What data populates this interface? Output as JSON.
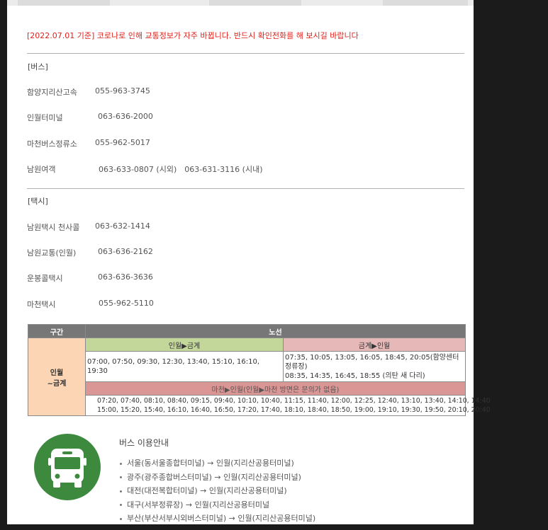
{
  "notice": {
    "prefix": "[2022.07.01 기준]",
    "text": " 코로나로 인해 교통정보가 자주 바뀝니다. 반드시 확인전화를 해 보시길 바랍니다"
  },
  "bus_section": {
    "title": "[버스]",
    "items": [
      {
        "name": "함양지리산고속",
        "phone": "055-963-3745"
      },
      {
        "name": "인월터미널",
        "phone": "063-636-2000"
      },
      {
        "name": "마천버스정류소",
        "phone": "055-962-5017"
      },
      {
        "name": "남원여객",
        "phone": "063-633-0807 (시외)　063-631-3116 (시내)"
      }
    ]
  },
  "taxi_section": {
    "title": "[택시]",
    "items": [
      {
        "name": "남원택시 천사콜",
        "phone": "063-632-1414"
      },
      {
        "name": "남원교통(인월)",
        "phone": "063-636-2162"
      },
      {
        "name": "운봉콜택시",
        "phone": "063-636-3636"
      },
      {
        "name": "마천택시",
        "phone": "055-962-5110"
      }
    ]
  },
  "timetable": {
    "col_section": "구간",
    "col_route": "노선",
    "section_name_line1": "인월",
    "section_name_line2": "~금계",
    "route_a": "인월▶금계",
    "route_b": "금계▶인월",
    "route_a_times": "07:00, 07:50, 09:30, 12:30, 13:40, 15:10, 16:10, 19:30",
    "route_b_times_1": "07:35, 10:05, 13:05, 16:05, 18:45, 20:05(함양센터 정류장)",
    "route_b_times_2": "08:35, 14:35, 16:45, 18:55 (의탄 새 다리)",
    "route_c": "마천▶인월(인월▶마천 방면은 문의가 없음)",
    "route_c_times_1": "07:20, 07:40, 08:10, 08:40, 09:15, 09:40, 10:10, 10:40, 11:15, 11:40, 12:00, 12:25, 12:40, 13:10, 13:40, 14:10, 14:40",
    "route_c_times_2": "15:00, 15:20, 15:40, 16:10, 16:40, 16:50, 17:20, 17:40, 18:10, 18:40, 18:50, 19:00, 19:10, 19:30, 19:50, 20:10, 20:40"
  },
  "bus_guide": {
    "icon": "bus-icon",
    "title": "버스 이용안내",
    "items": [
      "서울(동서울종합터미널) → 인월(지리산공용터미널)",
      "광주(광주종합버스터미널) → 인월(지리산공용터미널)",
      "대전(대전복합터미널) → 인월(지리산공용터미널)",
      "대구(서부정류장) → 인월(지리산공용터미널",
      "부산(부산서부시외버스터미널) → 인월(지리산공용터미널)"
    ]
  },
  "colors": {
    "notice": "#e0201a",
    "header_gray": "#777777",
    "section_orange": "#fcd5b4",
    "route_green": "#c4d79b",
    "route_pink": "#e6b8b7",
    "route_pink_dark": "#da9694",
    "bus_icon": "#3d8a3f"
  }
}
